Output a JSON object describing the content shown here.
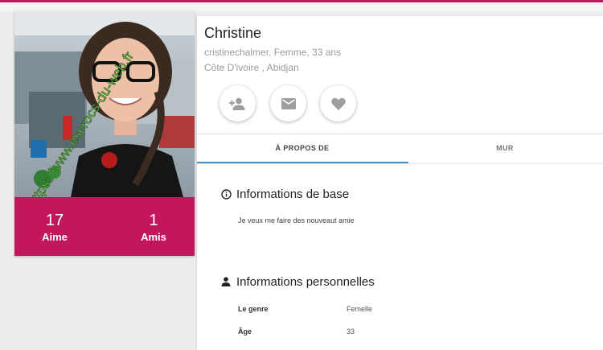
{
  "watermark": "https://www.escrocs-du-web.fr",
  "profile": {
    "name": "Christine",
    "meta_line1": "cristinechalmer, Femme, 33 ans",
    "meta_line2": "Côte D'ivoire , Abidjan"
  },
  "stats": {
    "likes_count": "17",
    "likes_label": "Aime",
    "friends_count": "1",
    "friends_label": "Amis"
  },
  "actions": [
    {
      "icon": "add-friend-icon"
    },
    {
      "icon": "mail-icon"
    },
    {
      "icon": "heart-icon"
    }
  ],
  "tabs": [
    {
      "label": "À PROPOS DE",
      "active": true
    },
    {
      "label": "MUR",
      "active": false
    }
  ],
  "basic_info": {
    "title": "Informations de base",
    "icon": "info-icon",
    "text": "Je veux me faire des nouveaut amie"
  },
  "personal_info": {
    "title": "Informations personnelles",
    "icon": "person-icon",
    "rows": [
      {
        "label": "Le genre",
        "value": "Femelle"
      },
      {
        "label": "Âge",
        "value": "33"
      }
    ]
  },
  "colors": {
    "accent": "#c2185b",
    "tab_indicator": "#4a90c4"
  }
}
